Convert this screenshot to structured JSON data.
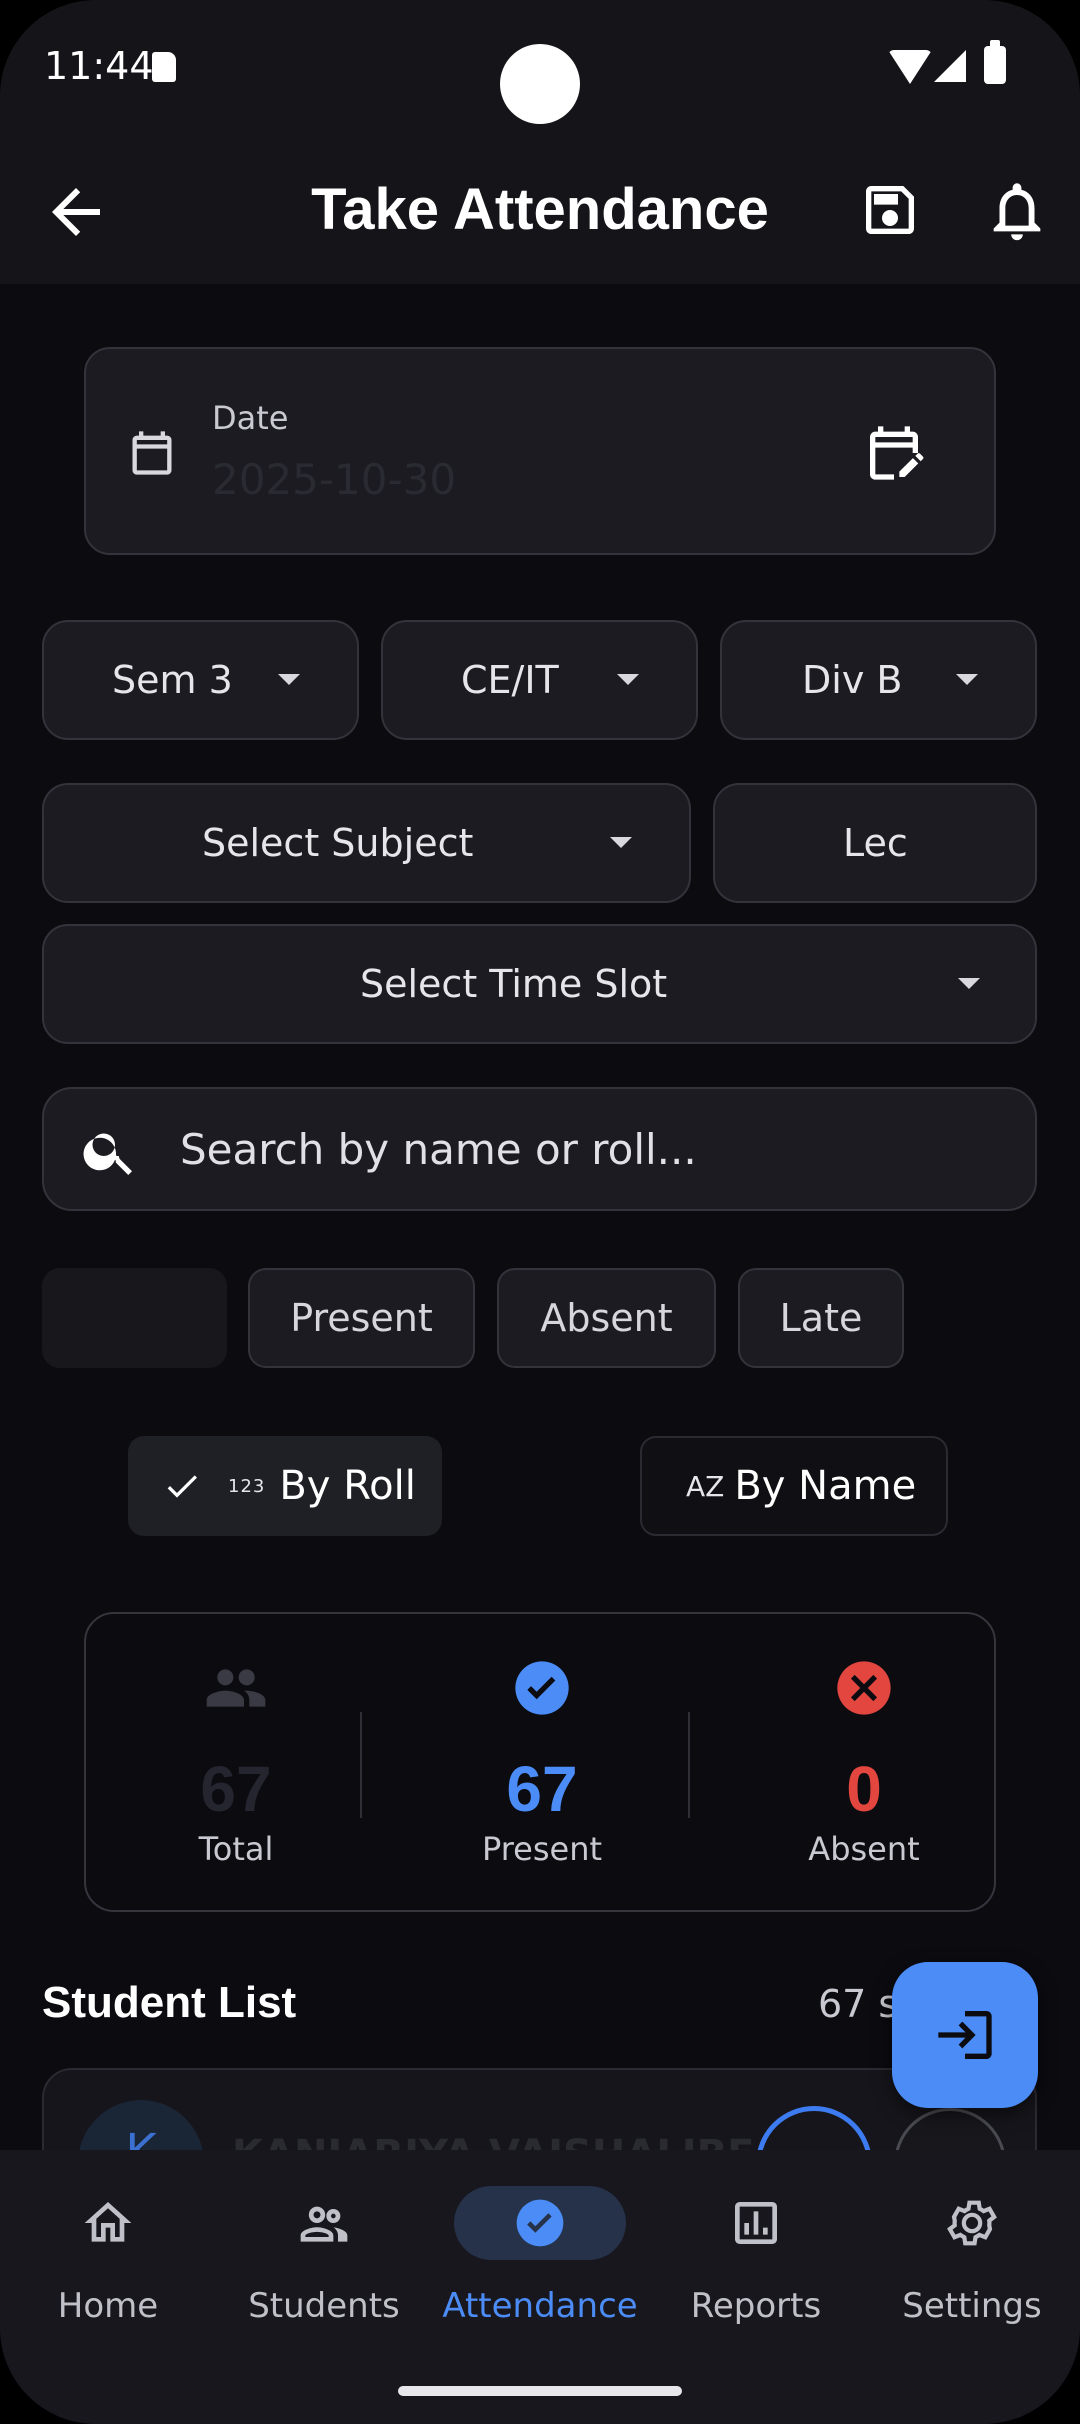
{
  "status_bar": {
    "time": "11:44"
  },
  "app_bar": {
    "title": "Take Attendance",
    "icons": [
      "back-arrow-icon",
      "save-icon",
      "bell-icon"
    ]
  },
  "date_field": {
    "label": "Date",
    "value": "2025-10-30"
  },
  "filters": {
    "semester": "Sem 3",
    "branch": "CE/IT",
    "division": "Div B",
    "subject": "Select Subject",
    "type": "Lec",
    "time_slot": "Select Time Slot"
  },
  "search": {
    "placeholder": "Search by name or roll..."
  },
  "status_chips": [
    "",
    "Present",
    "Absent",
    "Late"
  ],
  "sort": {
    "by_roll": {
      "tag": "123",
      "label": "By Roll",
      "selected": true
    },
    "by_name": {
      "tag": "AZ",
      "label": "By Name",
      "selected": false
    }
  },
  "stats": {
    "total": {
      "value": "67",
      "label": "Total"
    },
    "present": {
      "value": "67",
      "label": "Present"
    },
    "absent": {
      "value": "0",
      "label": "Absent"
    }
  },
  "student_list": {
    "title": "Student List",
    "count_text": "67 s",
    "rows": [
      {
        "initial": "K",
        "name": "KANJARIYA VAISHALIBE..."
      }
    ]
  },
  "bottom_nav": {
    "items": [
      {
        "label": "Home",
        "icon": "home-icon"
      },
      {
        "label": "Students",
        "icon": "people-icon"
      },
      {
        "label": "Attendance",
        "icon": "check-circle-icon",
        "active": true
      },
      {
        "label": "Reports",
        "icon": "bar-chart-icon"
      },
      {
        "label": "Settings",
        "icon": "gear-icon"
      }
    ]
  },
  "colors": {
    "accent": "#4b8cf7",
    "absent": "#e2463f",
    "background": "#0b0b10",
    "surface": "#1b1b21"
  }
}
